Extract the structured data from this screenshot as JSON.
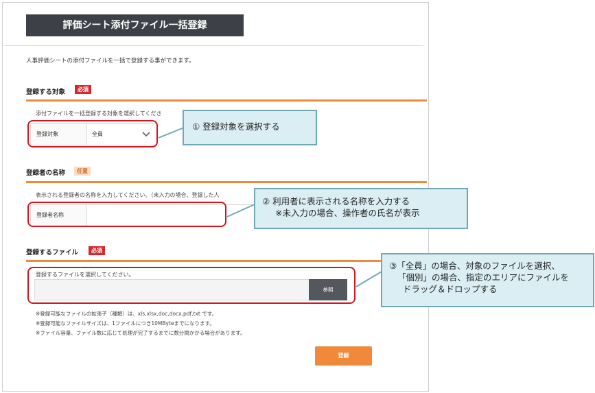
{
  "header": {
    "title": "評価シート添付ファイル一括登録"
  },
  "description": "人事評価シートの添付ファイルを一括で登録する事ができます。",
  "section_target": {
    "title": "登録する対象",
    "badge": "必須",
    "hint": "添付ファイルを一括登録する対象を選択してくださ",
    "field_label": "登録対象",
    "selected_value": "全員"
  },
  "section_name": {
    "title": "登録者の名称",
    "badge": "任意",
    "hint": "表示される登録者の名称を入力してください。（未入力の場合、登録した人",
    "field_label": "登録者名称",
    "input_value": ""
  },
  "section_file": {
    "title": "登録するファイル",
    "badge": "必須",
    "hint": "登録するファイルを選択してください。",
    "browse_label": "参照",
    "notes": [
      "※登録可能なファイルの拡張子（種類）は、xls,xlsx,doc,docx,pdf,txt です。",
      "※登録可能なファイルサイズは、1ファイルにつき10MByteまでになります。",
      "※ファイル容量、ファイル数に応じて処理が完了するまでに数分間かかる場合があります。"
    ]
  },
  "submit_label": "登録",
  "callouts": {
    "c1": "① 登録対象を選択する",
    "c2_line1": "② 利用者に表示される名称を入力する",
    "c2_line2": "※未入力の場合、操作者の氏名が表示",
    "c3_line1": "③「全員」の場合、対象のファイルを選択、",
    "c3_line2": "「個別」の場合、指定のエリアにファイルを",
    "c3_line3": "ドラッグ＆ドロップする"
  },
  "colors": {
    "header_bg": "#3d4046",
    "accent_orange": "#f08a3a",
    "required_red": "#d7282f",
    "highlight_red": "#d6131d",
    "callout_bg": "#dbeef4",
    "callout_border": "#6fa8b8"
  },
  "icons": {
    "select_arrow": "chevron-down-icon"
  }
}
